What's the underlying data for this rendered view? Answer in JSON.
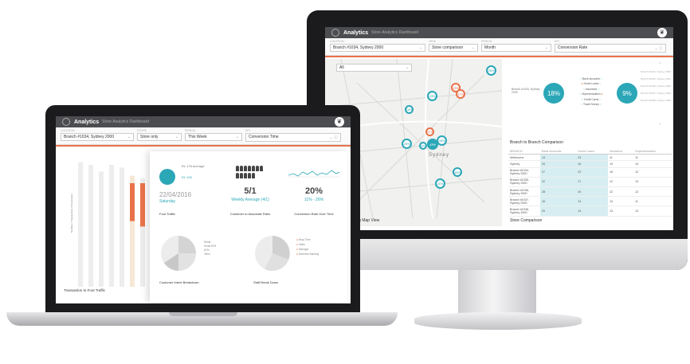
{
  "desktop": {
    "header": {
      "brand": "Analytics",
      "subtitle": "Store Analytics Dashboard"
    },
    "filters": [
      {
        "label": "Location",
        "value": "Branch #1034, Sydney 2000"
      },
      {
        "label": "View",
        "value": "Store comparison"
      },
      {
        "label": "Period",
        "value": "Month"
      },
      {
        "label": "KPI",
        "value": "Conversion Rate"
      }
    ],
    "map": {
      "dropdown": "All",
      "city_label": "Sydney",
      "circles": [
        "26%",
        "13%",
        "17%",
        "23%",
        "28%",
        "25%",
        "22%",
        "43%",
        "21%",
        "18%",
        "21%",
        "24%"
      ],
      "caption": "Comparison Map View"
    },
    "comparison": {
      "left_branch": "Branch #1034, Sydney 2000",
      "left_value": "18%",
      "right_value": "9%",
      "categories": [
        "Bank Accounts",
        "Home Loans",
        "Insurance",
        "Superannuation",
        "Credit Cards",
        "Travel Money"
      ],
      "side_branches": [
        "Branch #1024, Sydney 2000",
        "Branch #1025, Sydney 2000",
        "Branch #1026, Sydney 2000",
        "Branch #1027, Sydney 2000",
        "Branch #1028, Sydney 2000"
      ],
      "table_title": "Branch to Branch Comparison",
      "columns": [
        "BRANCH",
        "Bank Accounts",
        "Home Loans",
        "Insurance",
        "Superannuation"
      ],
      "rows": [
        {
          "branch": "Melbourne",
          "values": [
            "14",
            "23",
            "11",
            "11"
          ]
        },
        {
          "branch": "Sydney",
          "values": [
            "20",
            "16",
            "13",
            "13"
          ]
        },
        {
          "branch": "Branch #1034, Sydney 2000",
          "values": [
            "27",
            "22",
            "16",
            "12"
          ]
        },
        {
          "branch": "Branch #1035, Sydney 2000",
          "values": [
            "22",
            "17",
            "12",
            "13"
          ]
        },
        {
          "branch": "Branch #1036, Sydney 2000",
          "values": [
            "28",
            "20",
            "12",
            "12"
          ]
        },
        {
          "branch": "Branch #1037, Sydney 2000",
          "values": [
            "16",
            "13",
            "13",
            "11"
          ]
        },
        {
          "branch": "Branch #1038, Sydney 2000",
          "values": [
            "20",
            "13",
            "13",
            "13"
          ]
        }
      ],
      "caption": "Store Comparison"
    }
  },
  "laptop": {
    "header": {
      "brand": "Analytics",
      "subtitle": "Store Analytics Dashboard"
    },
    "filters": [
      {
        "label": "Location",
        "value": "Branch #1034, Sydney 2000"
      },
      {
        "label": "Store",
        "value": "Store only"
      },
      {
        "label": "Period",
        "value": "This Week"
      },
      {
        "label": "KPI",
        "value": "Conversion Time"
      }
    ],
    "left_chart": {
      "ylabel": "Number / Transactions of Customers",
      "caption": "Transaction to Foot Traffic",
      "bars_top": [
        0.92,
        0.9,
        0.85,
        0.9,
        0.88,
        0.82,
        0.8
      ],
      "bars_highlight": [
        0,
        0,
        0,
        0,
        0,
        0.28,
        0.32
      ]
    },
    "cards": {
      "foot_traffic": {
        "in_label": "IN: 176 Average",
        "in_value": "IN: 100",
        "date": "22/04/2016",
        "day": "Saturday",
        "caption": "Foot Traffic"
      },
      "associates": {
        "value": "5/1",
        "sub": "Weekly Average (4/1)",
        "caption": "Customer to Associate Ratio"
      },
      "conversion": {
        "value": "20%",
        "sub": "11% - 26%",
        "caption": "Conversion Rate Over Time"
      },
      "intent": {
        "legend": [
          "Retail",
          "Small ATM",
          "ATM",
          "Other"
        ],
        "caption": "Customer Intent Breakdown"
      },
      "staff": {
        "legend": [
          "Busy Time",
          "Sales",
          "Manager",
          "Business Banking"
        ],
        "caption": "Staff Break Down"
      }
    }
  }
}
